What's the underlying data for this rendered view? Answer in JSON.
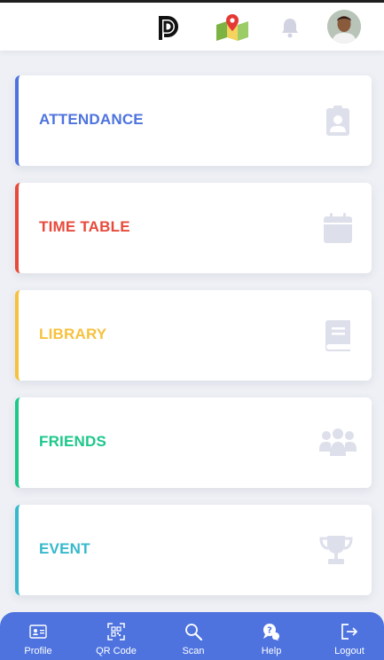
{
  "colors": {
    "primary": "#4e73df",
    "attendance": "#4e73df",
    "timetable": "#e74a3b",
    "library": "#f6c23e",
    "friends": "#1cc88a",
    "event": "#36b9cc",
    "icon_muted": "#dddfeb"
  },
  "header": {
    "icons": [
      "pd-logo-icon",
      "map-pin-icon",
      "bell-icon",
      "user-avatar"
    ]
  },
  "cards": [
    {
      "label": "ATTENDANCE",
      "icon": "clipboard-user-icon"
    },
    {
      "label": "TIME TABLE",
      "icon": "calendar-icon"
    },
    {
      "label": "LIBRARY",
      "icon": "book-icon"
    },
    {
      "label": "FRIENDS",
      "icon": "users-icon"
    },
    {
      "label": "EVENT",
      "icon": "trophy-icon"
    }
  ],
  "nav": {
    "items": [
      {
        "label": "Profile",
        "icon": "id-card-icon"
      },
      {
        "label": "QR Code",
        "icon": "qrcode-icon"
      },
      {
        "label": "Scan",
        "icon": "search-icon"
      },
      {
        "label": "Help",
        "icon": "help-chat-icon"
      },
      {
        "label": "Logout",
        "icon": "logout-icon"
      }
    ]
  }
}
